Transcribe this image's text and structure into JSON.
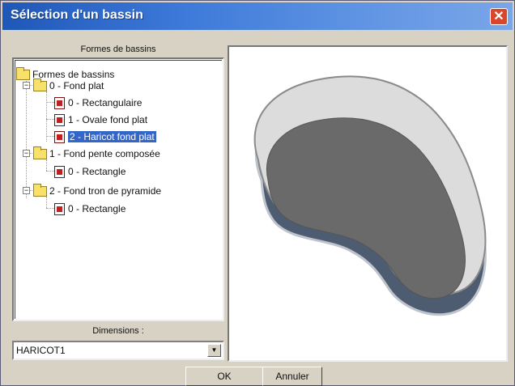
{
  "window": {
    "title": "Sélection d'un bassin",
    "close_glyph": "✕"
  },
  "tree": {
    "header": "Formes de bassins",
    "root": "Formes de bassins",
    "groups": [
      {
        "label": "0 - Fond plat",
        "expander": "−",
        "items": [
          "0 - Rectangulaire",
          "1 - Ovale fond plat",
          "2 - Haricot fond plat"
        ]
      },
      {
        "label": "1 - Fond pente composée",
        "expander": "−",
        "items": [
          "0 - Rectangle"
        ]
      },
      {
        "label": "2 - Fond tron de pyramide",
        "expander": "−",
        "items": [
          "0 - Rectangle"
        ]
      }
    ],
    "selected": "2 - Haricot fond plat"
  },
  "dimensions": {
    "label": "Dimensions :",
    "value": "HARICOT1",
    "arrow": "▼"
  },
  "buttons": {
    "ok": "OK",
    "cancel": "Annuler"
  },
  "icons": {
    "folder": "folder-icon",
    "document": "pool-shape-icon",
    "expander": "collapse-icon"
  },
  "colors": {
    "titlebar": "#2f6ccc",
    "selection": "#3466c7",
    "pool_fill": "#6a6a6a",
    "pool_wall": "#4e5c72"
  }
}
